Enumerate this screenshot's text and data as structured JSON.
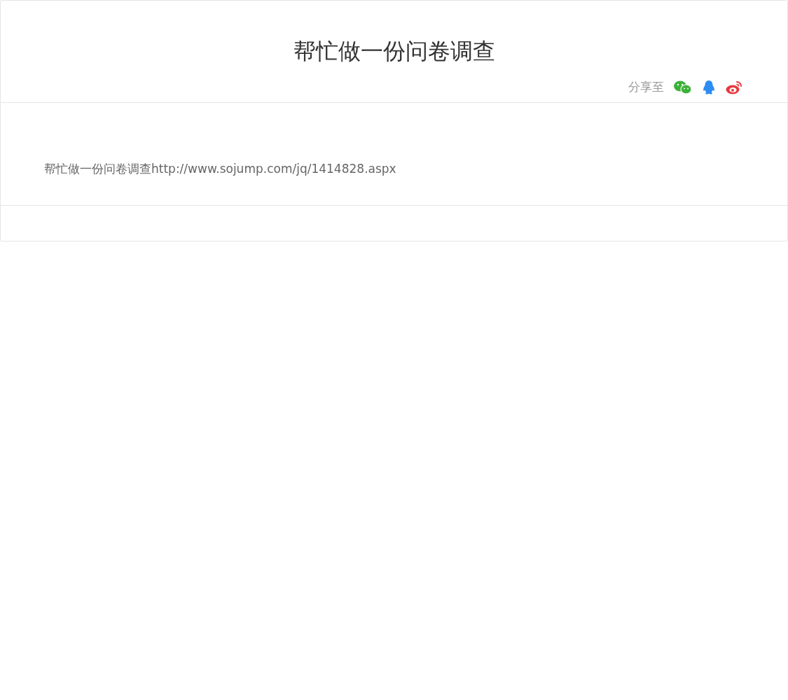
{
  "title": "帮忙做一份问卷调查",
  "share": {
    "label": "分享至",
    "targets": [
      {
        "kind": "wechat"
      },
      {
        "kind": "qq"
      },
      {
        "kind": "weibo"
      }
    ]
  },
  "body": "帮忙做一份问卷调查http://www.sojump.com/jq/1414828.aspx"
}
